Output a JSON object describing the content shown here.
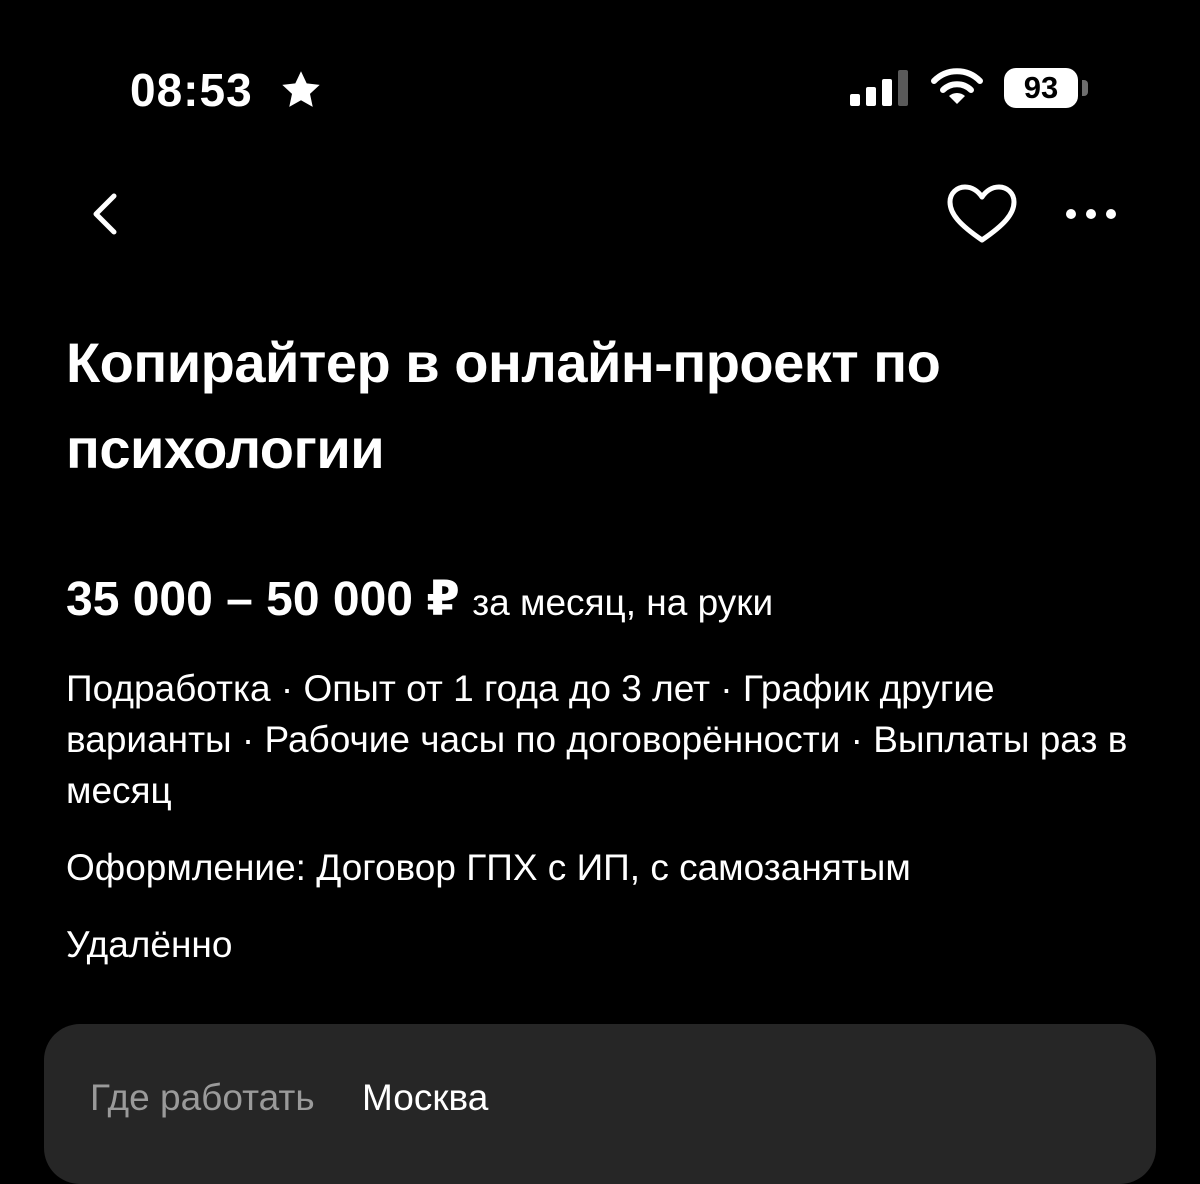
{
  "status_bar": {
    "time": "08:53",
    "battery_level": "93"
  },
  "nav": {
    "icons": [
      "back-icon",
      "heart-icon",
      "more-icon"
    ]
  },
  "vacancy": {
    "title": "Копирайтер в онлайн-проект по психологии",
    "salary_amount": "35 000 – 50 000 ₽",
    "salary_note": "за месяц, на руки",
    "conditions": "Подработка · Опыт от 1 года до 3 лет · График другие варианты · Рабочие часы по договорённости · Выплаты раз в месяц",
    "registration": "Оформление: Договор ГПХ с ИП, с самозанятым",
    "work_format": "Удалённо"
  },
  "location_card": {
    "label": "Где работать",
    "value": "Москва"
  },
  "colors": {
    "background": "#000000",
    "text": "#ffffff",
    "card_background": "#262626",
    "secondary_text": "#9a9a9a"
  }
}
